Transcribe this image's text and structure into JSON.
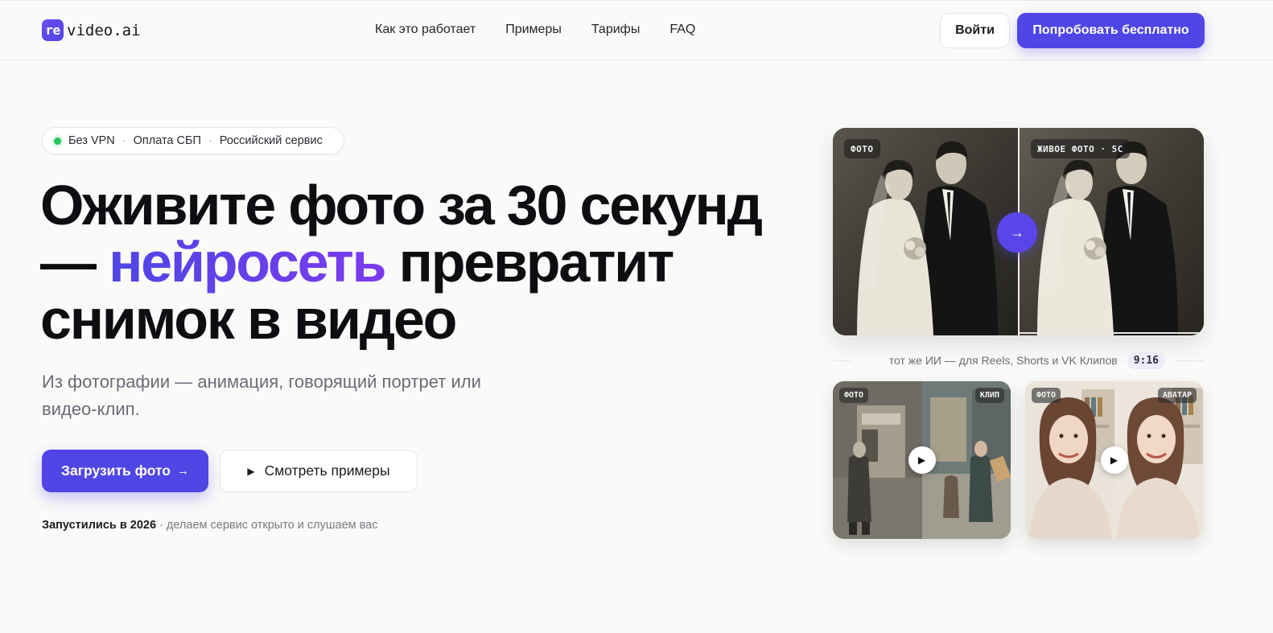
{
  "header": {
    "logo_mark": "re",
    "logo_text": "video.ai",
    "nav": [
      "Как это работает",
      "Примеры",
      "Тарифы",
      "FAQ"
    ],
    "login_label": "Войти",
    "try_label": "Попробовать бесплатно"
  },
  "hero": {
    "badge": [
      "Без VPN",
      "Оплата СБП",
      "Российский сервис"
    ],
    "badge_sep": "·",
    "headline_part1": "Оживите фото за 30 секунд — ",
    "headline_accent": "нейросеть",
    "headline_part2": " превратит снимок в видео",
    "subtitle": "Из фотографии — анимация, говорящий портрет или видео-клип.",
    "upload_label": "Загрузить фото",
    "upload_arrow": "→",
    "examples_label": "Смотреть примеры",
    "examples_icon": "▶",
    "launch_bold": "Запустились в 2026",
    "launch_rest": " · делаем сервис открыто и слушаем вас"
  },
  "showcase": {
    "main_tag_left": "ФОТО",
    "main_tag_right": "ЖИВОЕ ФОТО · 5С",
    "arrow": "→",
    "divider_text": "тот же ИИ — для Reels, Shorts и VK Клипов",
    "ratio": "9:16",
    "card1_tag_left": "ФОТО",
    "card1_tag_right": "КЛИП",
    "card2_tag_left": "ФОТО",
    "card2_tag_right": "АВАТАР",
    "play_icon": "▶"
  },
  "colors": {
    "accent": "#4f46e5",
    "accent_purple": "#7c3aed",
    "status_green": "#22c55e",
    "background": "#fafaf8"
  }
}
